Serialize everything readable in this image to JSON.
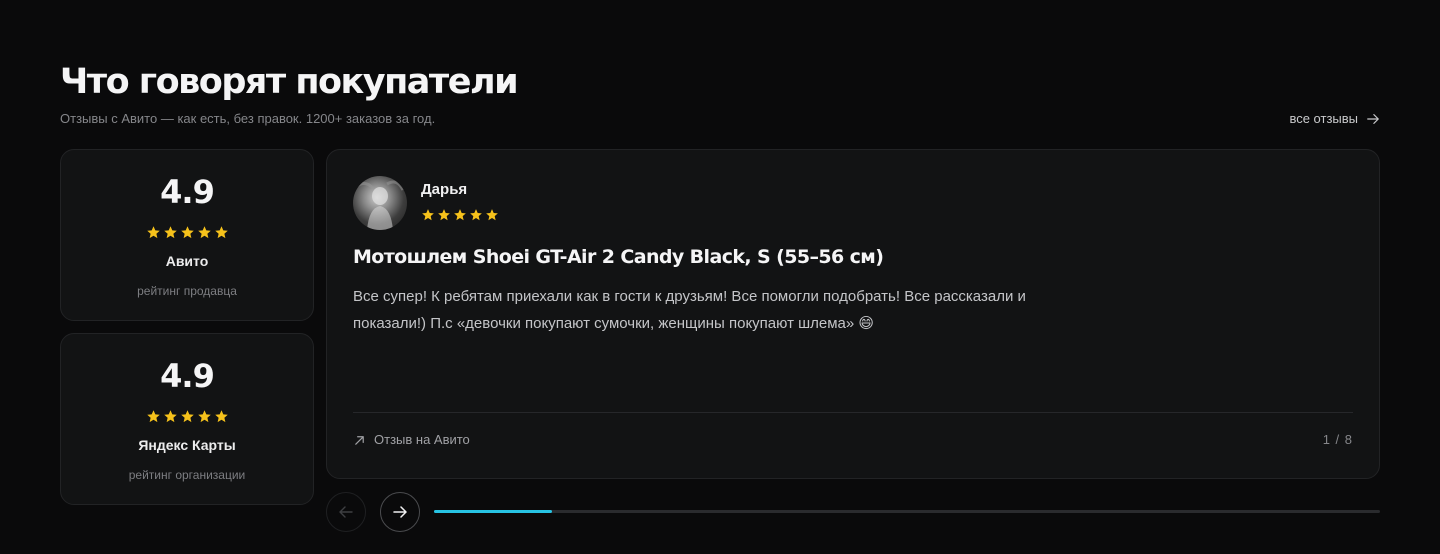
{
  "header": {
    "title": "Что говорят покупатели",
    "subtitle": "Отзывы с Авито — как есть, без правок. 1200+ заказов за год.",
    "all_reviews_label": "все отзывы",
    "all_reviews_icon": "arrow-right-icon"
  },
  "ratings": [
    {
      "score": "4.9",
      "stars": 5,
      "source": "Авито",
      "caption": "рейтинг продавца"
    },
    {
      "score": "4.9",
      "stars": 5,
      "source": "Яндекс Карты",
      "caption": "рейтинг организации"
    }
  ],
  "review": {
    "author": "Дарья",
    "stars": 5,
    "product": "Мотошлем Shoei GT-Air 2 Candy Black, S (55–56 см)",
    "text": "Все супер! К ребятам приехали как в гости к друзьям! Все помогли подобрать! Все рассказали и показали!) П.с «девочки покупают сумочки, женщины покупают шлема» 😄",
    "source_label": "Отзыв на Авито",
    "counter": "1 / 8"
  },
  "slider": {
    "progress": 0.125,
    "prev_icon": "arrow-left-icon",
    "next_icon": "arrow-right-icon"
  },
  "colors": {
    "background": "#0a0a0b",
    "card": "#121314",
    "star": "#f6c21b",
    "accent": "#27c3e3"
  }
}
